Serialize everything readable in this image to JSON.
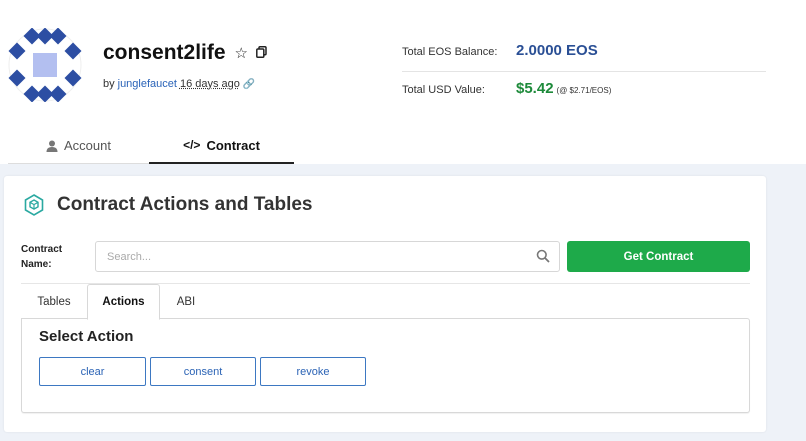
{
  "account": {
    "name": "consent2life",
    "by_prefix": "by",
    "author": "junglefaucet",
    "created": "16 days ago"
  },
  "balance": {
    "eos_label": "Total EOS Balance:",
    "eos_value": "2.0000 EOS",
    "usd_label": "Total USD Value:",
    "usd_value": "$5.42",
    "usd_rate": "(@ $2.71/EOS)"
  },
  "top_tabs": {
    "account": "Account",
    "contract": "Contract"
  },
  "contract": {
    "title": "Contract Actions and Tables",
    "name_label": "Contract Name:",
    "search_placeholder": "Search...",
    "get_button": "Get Contract"
  },
  "sub_tabs": {
    "tables": "Tables",
    "actions": "Actions",
    "abi": "ABI"
  },
  "actions_panel": {
    "title": "Select Action",
    "buttons": [
      "clear",
      "consent",
      "revoke"
    ]
  },
  "icons": {
    "star": "star-outline-icon",
    "copy": "copy-icon",
    "link": "link-icon",
    "user": "user-icon",
    "code": "code-icon",
    "contract": "hexagon-cubes-icon",
    "search": "search-icon"
  },
  "colors": {
    "eos_blue": "#2a4f95",
    "usd_green": "#1d8a3a",
    "primary_green": "#1eaa4a",
    "action_blue": "#2b63b5",
    "avatar_blue": "#2d4ea3"
  }
}
